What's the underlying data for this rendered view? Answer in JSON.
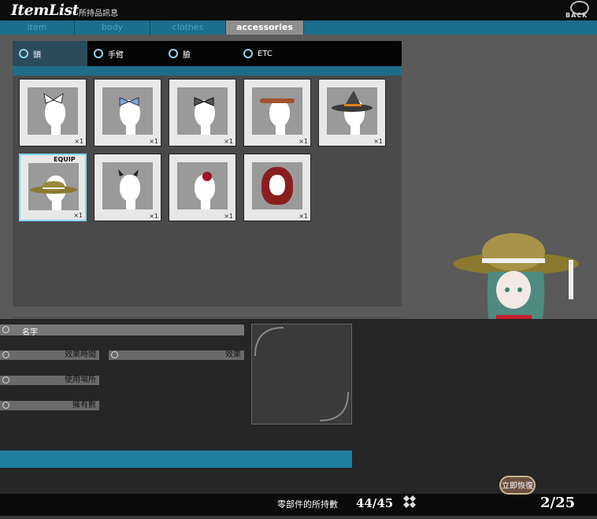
{
  "header": {
    "logo": "ItemList",
    "subtitle": "所持品訊息",
    "back_label": "BACK"
  },
  "categories": [
    {
      "label": "item",
      "active": false
    },
    {
      "label": "body",
      "active": false
    },
    {
      "label": "clothes",
      "active": false
    },
    {
      "label": "accessories",
      "active": true
    }
  ],
  "subtabs": [
    {
      "label": "頭",
      "active": true
    },
    {
      "label": "手臂",
      "active": false
    },
    {
      "label": "臉",
      "active": false
    },
    {
      "label": "ETC",
      "active": false
    }
  ],
  "items": [
    {
      "name": "white-ribbon",
      "count": "×1",
      "equip": ""
    },
    {
      "name": "blue-bow",
      "count": "×1",
      "equip": ""
    },
    {
      "name": "black-bow",
      "count": "×1",
      "equip": ""
    },
    {
      "name": "braid-band",
      "count": "×1",
      "equip": ""
    },
    {
      "name": "witch-hat",
      "count": "×1",
      "equip": ""
    },
    {
      "name": "straw-hat",
      "count": "×1",
      "equip": "EQUIP"
    },
    {
      "name": "devil-horns",
      "count": "×1",
      "equip": ""
    },
    {
      "name": "red-flower",
      "count": "×1",
      "equip": ""
    },
    {
      "name": "red-hood",
      "count": "×1",
      "equip": ""
    }
  ],
  "info": {
    "name_label": "名字",
    "effect_time_label": "效果時間",
    "effect_label": "效果",
    "use_place_label": "使用場所",
    "owned_label": "擁有數"
  },
  "footer": {
    "count_label": "零部件的所持數",
    "count_value": "44/45",
    "restore_label": "立即恢復",
    "page_value": "2/25"
  },
  "colors": {
    "accent": "#1e7f9e",
    "selected_border": "#7fd8ef"
  }
}
